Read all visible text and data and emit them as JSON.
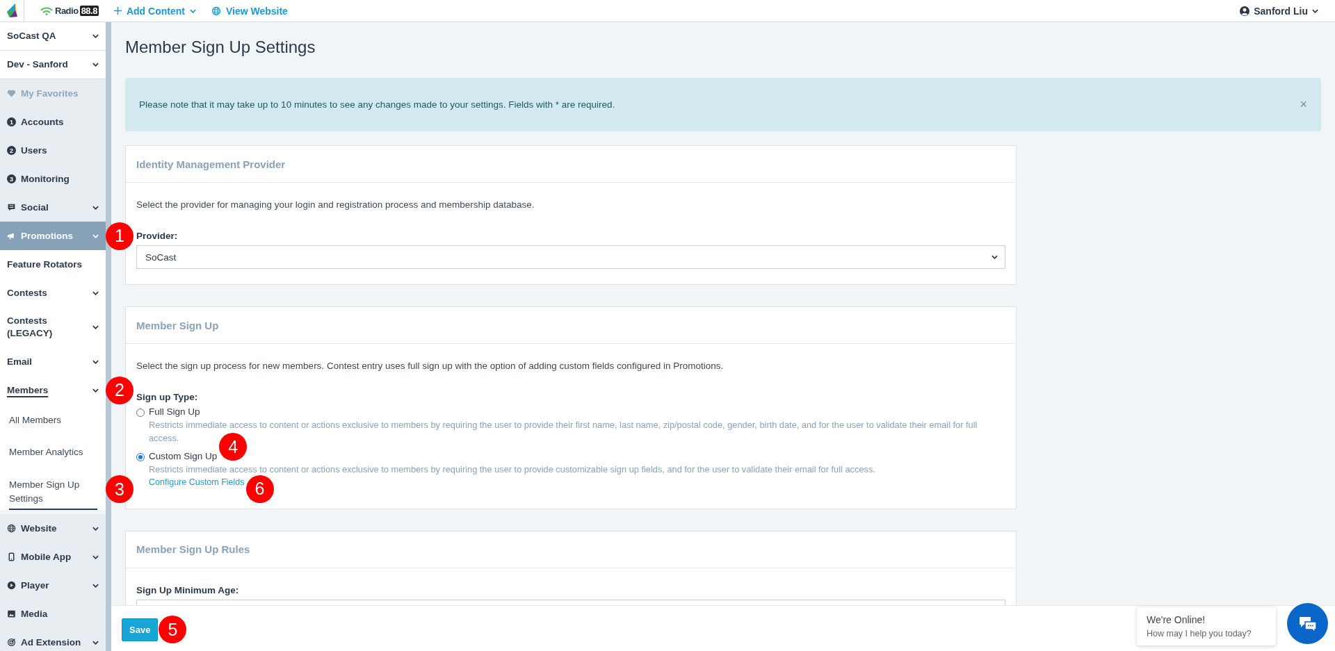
{
  "top_bar": {
    "brand_word": "Radio",
    "brand_number": "88.8",
    "add_content": "Add Content",
    "view_website": "View Website",
    "user": "Sanford Liu"
  },
  "sidebar": {
    "items": [
      {
        "label": "SoCast QA",
        "kind": "account",
        "expandable": true,
        "selected": false,
        "disabled": false
      },
      {
        "label": "Dev - Sanford",
        "kind": "account",
        "expandable": true,
        "selected": false,
        "disabled": false
      },
      {
        "label": "My Favorites",
        "kind": "module",
        "expandable": false,
        "selected": false,
        "disabled": true
      },
      {
        "label": "Accounts",
        "kind": "module",
        "badge": "1",
        "expandable": false,
        "selected": false,
        "disabled": false
      },
      {
        "label": "Users",
        "kind": "module",
        "badge": "2",
        "expandable": false,
        "selected": false,
        "disabled": false
      },
      {
        "label": "Monitoring",
        "kind": "module",
        "badge": "3",
        "expandable": false,
        "selected": false,
        "disabled": false
      },
      {
        "label": "Social",
        "kind": "module",
        "expandable": true,
        "selected": false,
        "disabled": false
      },
      {
        "label": "Promotions",
        "kind": "module",
        "expandable": true,
        "selected": true,
        "disabled": false,
        "marker": "1",
        "children": [
          {
            "label": "Feature Rotators",
            "expandable": false,
            "selected": false
          },
          {
            "label": "Contests",
            "expandable": true,
            "selected": false
          },
          {
            "label": "Contests (LEGACY)",
            "expandable": true,
            "selected": false
          },
          {
            "label": "Email",
            "expandable": true,
            "selected": false
          },
          {
            "label": "Members",
            "expandable": true,
            "selected": true,
            "marker": "2",
            "children": [
              {
                "label": "All Members",
                "selected": false
              },
              {
                "label": "Member Analytics",
                "selected": false
              },
              {
                "label": "Member Sign Up Settings",
                "selected": true,
                "marker": "3"
              }
            ]
          }
        ]
      },
      {
        "label": "Website",
        "kind": "module",
        "expandable": true,
        "selected": false,
        "disabled": false
      },
      {
        "label": "Mobile App",
        "kind": "module",
        "expandable": true,
        "selected": false,
        "disabled": false
      },
      {
        "label": "Player",
        "kind": "module",
        "expandable": true,
        "selected": false,
        "disabled": false
      },
      {
        "label": "Media",
        "kind": "module",
        "expandable": false,
        "selected": false,
        "disabled": false
      },
      {
        "label": "Ad Extension",
        "kind": "module",
        "expandable": true,
        "selected": false,
        "disabled": false
      }
    ]
  },
  "page_title": "Member Sign Up Settings",
  "alert": {
    "text": "Please note that it may take up to 10 minutes to see any changes made to your settings. Fields with * are required.",
    "close": "×"
  },
  "cards": [
    {
      "kind": "select",
      "title": "Identity Management Provider",
      "description": "Select the provider for managing your login and registration process and membership database.",
      "field_label": "Provider:",
      "value": "SoCast"
    },
    {
      "kind": "radio",
      "title": "Member Sign Up",
      "description": "Select the sign up process for new members. Contest entry uses full sign up with the option of adding custom fields configured in Promotions.",
      "field_label": "Sign up Type:",
      "options": [
        {
          "label": "Full Sign Up",
          "selected": false,
          "description": "Restricts immediate access to content or actions exclusive to members by requiring the user to provide their first name, last name, zip/postal code, gender, birth date, and for the user to validate their email for full access."
        },
        {
          "label": "Custom Sign Up",
          "selected": true,
          "marker": "4",
          "description": "Restricts immediate access to content or actions exclusive to members by requiring the user to provide customizable sign up fields, and for the user to validate their email for full access.",
          "link": "Configure Custom Fields",
          "link_marker": "6"
        }
      ]
    },
    {
      "kind": "input",
      "title": "Member Sign Up Rules",
      "field_label": "Sign Up Minimum Age:"
    }
  ],
  "footer": {
    "save": "Save",
    "save_marker": "5"
  },
  "chat": {
    "title": "We're Online!",
    "subtitle": "How may I help you today?"
  }
}
